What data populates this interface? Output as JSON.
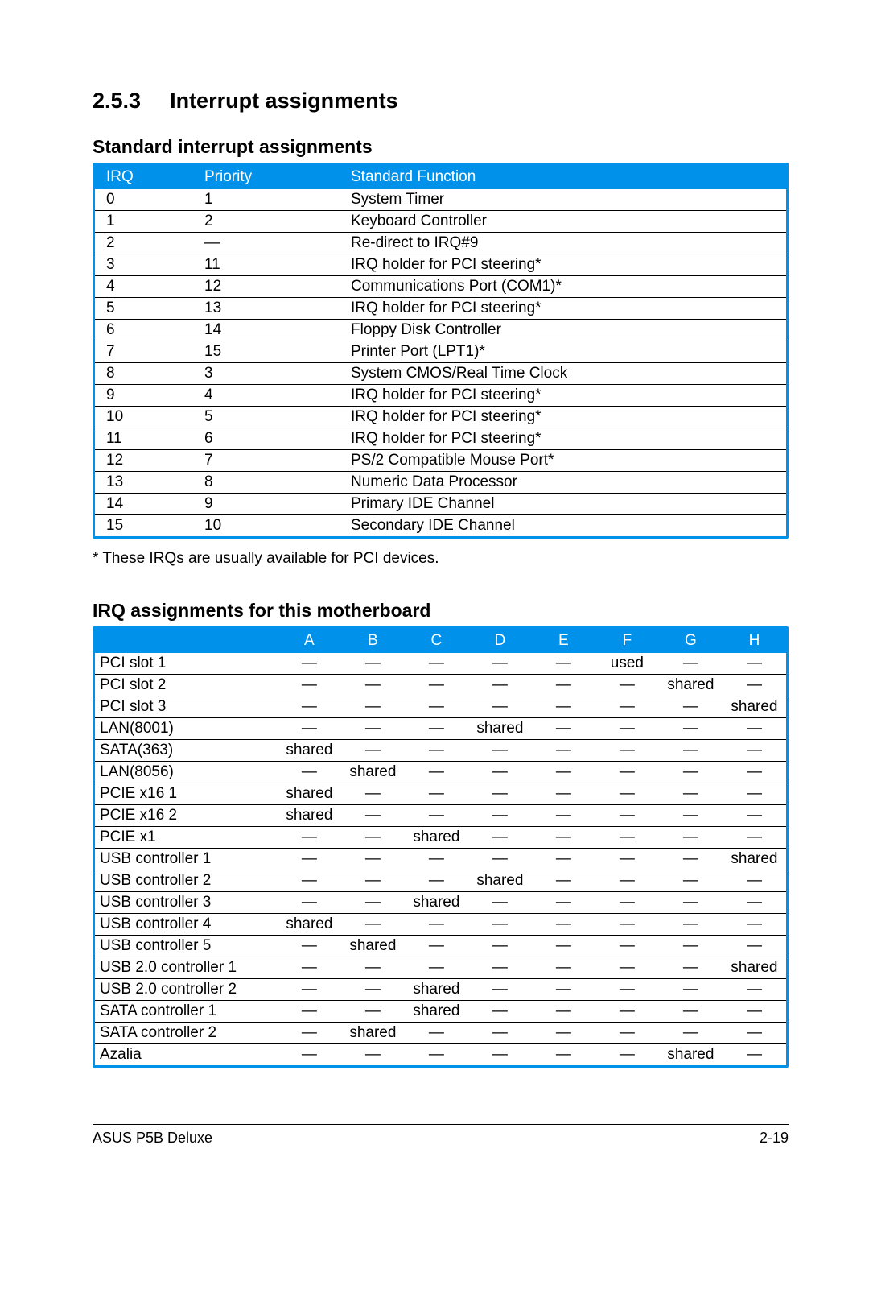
{
  "section": {
    "number": "2.5.3",
    "title": "Interrupt assignments"
  },
  "table1": {
    "title": "Standard interrupt assignments",
    "headers": {
      "irq": "IRQ",
      "priority": "Priority",
      "func": "Standard Function"
    },
    "rows": [
      {
        "irq": "0",
        "priority": "1",
        "func": "System Timer"
      },
      {
        "irq": "1",
        "priority": "2",
        "func": "Keyboard Controller"
      },
      {
        "irq": "2",
        "priority": "—",
        "func": "Re-direct to IRQ#9"
      },
      {
        "irq": "3",
        "priority": "11",
        "func": "IRQ holder for PCI steering*"
      },
      {
        "irq": "4",
        "priority": "12",
        "func": "Communications Port (COM1)*"
      },
      {
        "irq": "5",
        "priority": "13",
        "func": "IRQ holder for PCI steering*"
      },
      {
        "irq": "6",
        "priority": "14",
        "func": "Floppy Disk Controller"
      },
      {
        "irq": "7",
        "priority": "15",
        "func": "Printer Port (LPT1)*"
      },
      {
        "irq": "8",
        "priority": "3",
        "func": "System CMOS/Real Time Clock"
      },
      {
        "irq": "9",
        "priority": "4",
        "func": "IRQ holder for PCI steering*"
      },
      {
        "irq": "10",
        "priority": "5",
        "func": "IRQ holder for PCI steering*"
      },
      {
        "irq": "11",
        "priority": "6",
        "func": "IRQ holder for PCI steering*"
      },
      {
        "irq": "12",
        "priority": "7",
        "func": "PS/2 Compatible Mouse Port*"
      },
      {
        "irq": "13",
        "priority": "8",
        "func": "Numeric Data Processor"
      },
      {
        "irq": "14",
        "priority": "9",
        "func": "Primary IDE Channel"
      },
      {
        "irq": "15",
        "priority": "10",
        "func": "Secondary IDE Channel"
      }
    ],
    "footnote": "* These IRQs are usually available for PCI devices."
  },
  "table2": {
    "title": "IRQ assignments for this motherboard",
    "headers": [
      "",
      "A",
      "B",
      "C",
      "D",
      "E",
      "F",
      "G",
      "H"
    ],
    "rows": [
      {
        "dev": "PCI slot 1",
        "v": [
          "—",
          "—",
          "—",
          "—",
          "—",
          "used",
          "—",
          "—"
        ]
      },
      {
        "dev": "PCI slot 2",
        "v": [
          "—",
          "—",
          "—",
          "—",
          "—",
          "—",
          "shared",
          "—"
        ]
      },
      {
        "dev": "PCI slot 3",
        "v": [
          "—",
          "—",
          "—",
          "—",
          "—",
          "—",
          "—",
          "shared"
        ]
      },
      {
        "dev": "LAN(8001)",
        "v": [
          "—",
          "—",
          "—",
          "shared",
          "—",
          "—",
          "—",
          "—"
        ]
      },
      {
        "dev": "SATA(363)",
        "v": [
          "shared",
          "—",
          "—",
          "—",
          "—",
          "—",
          "—",
          "—"
        ]
      },
      {
        "dev": "LAN(8056)",
        "v": [
          "—",
          "shared",
          "—",
          "—",
          "—",
          "—",
          "—",
          "—"
        ]
      },
      {
        "dev": "PCIE x16 1",
        "v": [
          "shared",
          "—",
          "—",
          "—",
          "—",
          "—",
          "—",
          "—"
        ]
      },
      {
        "dev": "PCIE x16 2",
        "v": [
          "shared",
          "—",
          "—",
          "—",
          "—",
          "—",
          "—",
          "—"
        ]
      },
      {
        "dev": "PCIE x1",
        "v": [
          "—",
          "—",
          "shared",
          "—",
          "—",
          "—",
          "—",
          "—"
        ]
      },
      {
        "dev": "USB controller 1",
        "v": [
          "—",
          "—",
          "—",
          "—",
          "—",
          "—",
          "—",
          "shared"
        ]
      },
      {
        "dev": "USB controller 2",
        "v": [
          "—",
          "—",
          "—",
          "shared",
          "—",
          "—",
          "—",
          "—"
        ]
      },
      {
        "dev": "USB controller 3",
        "v": [
          "—",
          "—",
          "shared",
          "—",
          "—",
          "—",
          "—",
          "—"
        ]
      },
      {
        "dev": "USB controller 4",
        "v": [
          "shared",
          "—",
          "—",
          "—",
          "—",
          "—",
          "—",
          "—"
        ]
      },
      {
        "dev": "USB controller 5",
        "v": [
          "—",
          "shared",
          "—",
          "—",
          "—",
          "—",
          "—",
          "—"
        ]
      },
      {
        "dev": "USB 2.0 controller 1",
        "v": [
          "—",
          "—",
          "—",
          "—",
          "—",
          "—",
          "—",
          "shared"
        ]
      },
      {
        "dev": "USB 2.0 controller 2",
        "v": [
          "—",
          "—",
          "shared",
          "—",
          "—",
          "—",
          "—",
          "—"
        ]
      },
      {
        "dev": "SATA controller 1",
        "v": [
          "—",
          "—",
          "shared",
          "—",
          "—",
          "—",
          "—",
          "—"
        ]
      },
      {
        "dev": "SATA controller 2",
        "v": [
          "—",
          "shared",
          "—",
          "—",
          "—",
          "—",
          "—",
          "—"
        ]
      },
      {
        "dev": "Azalia",
        "v": [
          "—",
          "—",
          "—",
          "—",
          "—",
          "—",
          "shared",
          "—"
        ]
      }
    ]
  },
  "footer": {
    "left": "ASUS P5B Deluxe",
    "right": "2-19"
  }
}
